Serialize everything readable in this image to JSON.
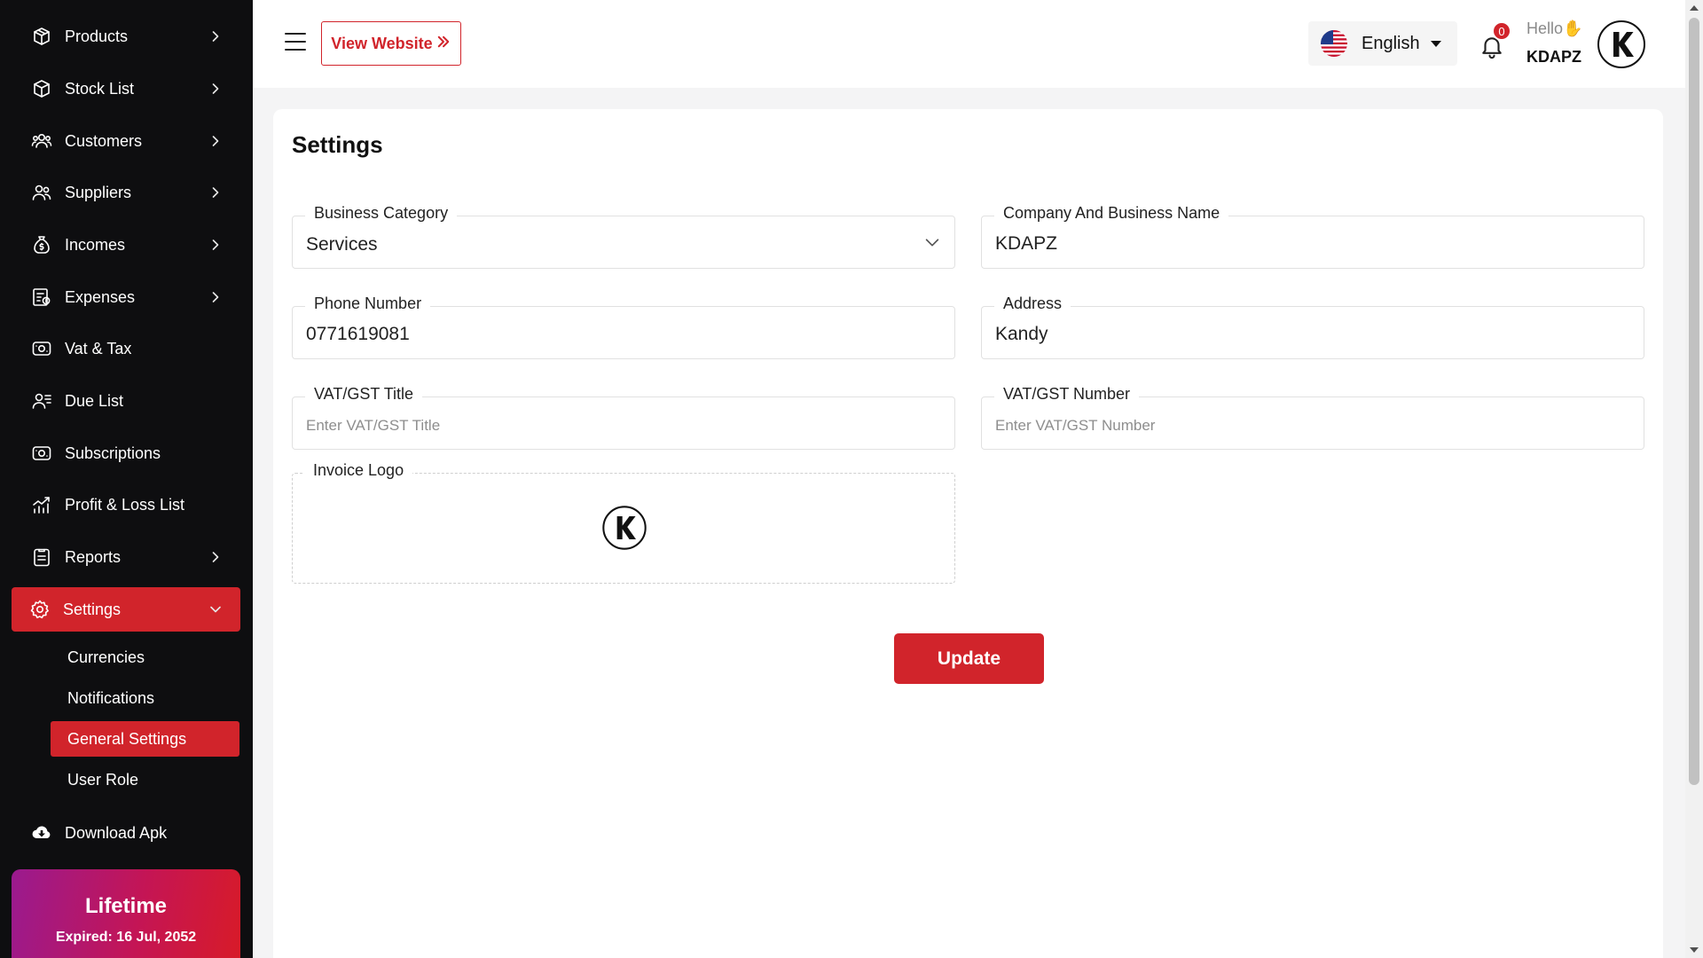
{
  "sidebar": {
    "items": [
      {
        "label": "Products",
        "icon": "box-icon"
      },
      {
        "label": "Stock List",
        "icon": "stock-icon"
      },
      {
        "label": "Customers",
        "icon": "customers-icon"
      },
      {
        "label": "Suppliers",
        "icon": "suppliers-icon"
      },
      {
        "label": "Incomes",
        "icon": "money-bag-icon"
      },
      {
        "label": "Expenses",
        "icon": "receipt-icon"
      },
      {
        "label": "Vat & Tax",
        "icon": "cash-icon"
      },
      {
        "label": "Due List",
        "icon": "due-list-icon"
      },
      {
        "label": "Subscriptions",
        "icon": "subscription-icon"
      },
      {
        "label": "Profit & Loss List",
        "icon": "chart-icon"
      },
      {
        "label": "Reports",
        "icon": "report-icon"
      },
      {
        "label": "Settings",
        "icon": "gear-icon"
      }
    ],
    "settings_sub": [
      "Currencies",
      "Notifications",
      "General Settings",
      "User Role"
    ],
    "download_apk": "Download Apk",
    "plan": {
      "title": "Lifetime",
      "expiry": "Expired: 16 Jul, 2052"
    }
  },
  "header": {
    "view_website": "View Website",
    "language": "English",
    "notification_count": "0",
    "greeting": "Hello",
    "greeting_emoji": "✋",
    "username": "KDAPZ"
  },
  "settings": {
    "title": "Settings",
    "fields": {
      "business_category": {
        "label": "Business Category",
        "value": "Services"
      },
      "company_name": {
        "label": "Company And Business Name",
        "value": "KDAPZ"
      },
      "phone": {
        "label": "Phone Number",
        "value": "0771619081"
      },
      "address": {
        "label": "Address",
        "value": "Kandy"
      },
      "vat_title": {
        "label": "VAT/GST Title",
        "placeholder": "Enter VAT/GST Title"
      },
      "vat_number": {
        "label": "VAT/GST Number",
        "placeholder": "Enter VAT/GST Number"
      }
    },
    "invoice_logo_label": "Invoice Logo",
    "update_label": "Update"
  },
  "colors": {
    "accent": "#d1242b",
    "sidebar_bg": "#0e0e10"
  }
}
